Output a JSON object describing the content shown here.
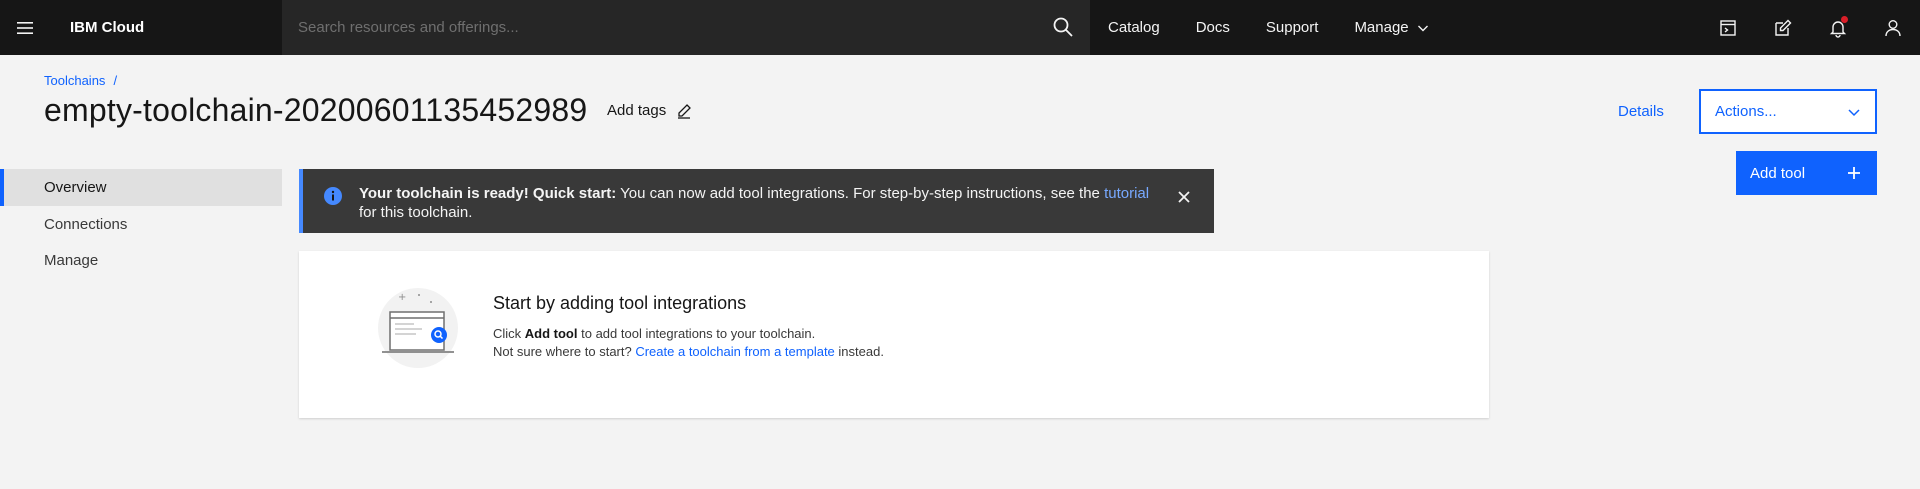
{
  "topbar": {
    "brand": "IBM Cloud",
    "search_placeholder": "Search resources and offerings...",
    "nav": [
      "Catalog",
      "Docs",
      "Support",
      "Manage"
    ],
    "right_icons": [
      "cost-estimator-icon",
      "edit-icon",
      "notification-icon",
      "user-icon"
    ]
  },
  "breadcrumb": {
    "item": "Toolchains",
    "separator": "/"
  },
  "page": {
    "title": "empty-toolchain-20200601135452989",
    "add_tags": "Add tags",
    "details": "Details",
    "actions": "Actions...",
    "add_tool": "Add tool"
  },
  "sidenav": {
    "items": [
      "Overview",
      "Connections",
      "Manage"
    ],
    "active": "Overview"
  },
  "notification": {
    "title": "Your toolchain is ready! Quick start:",
    "text_before": " You can now add tool integrations. For step-by-step instructions, see the",
    "link": "tutorial",
    "text_after": " for this toolchain."
  },
  "empty_state": {
    "heading": "Start by adding tool integrations",
    "line1_prefix": "Click ",
    "line1_bold": "Add tool",
    "line1_suffix": " to add tool integrations to your toolchain.",
    "line2_prefix": "Not sure where to start? ",
    "line2_link": "Create a toolchain from a template",
    "line2_suffix": " instead."
  },
  "colors": {
    "accent": "#0f62fe",
    "topbar_bg": "#161616",
    "search_bg": "#262626",
    "notification_bg": "#393939",
    "notification_dot": "#da1e28",
    "page_bg": "#f3f3f3"
  }
}
